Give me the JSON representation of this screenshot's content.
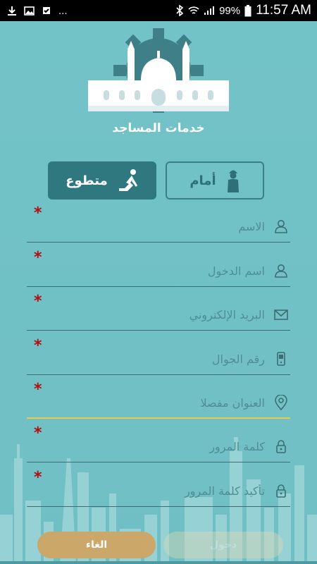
{
  "status_bar": {
    "battery": "99%",
    "time": "11:57 AM",
    "more": "..."
  },
  "app": {
    "title": "خدمات المساجد"
  },
  "roles": {
    "imam": "أمام",
    "volunteer": "متطوع"
  },
  "form": {
    "required_mark": "*",
    "fields": [
      {
        "placeholder": "الاسم",
        "icon": "user-icon"
      },
      {
        "placeholder": "اسم الدخول",
        "icon": "user-icon"
      },
      {
        "placeholder": "البريد الإلكتروني",
        "icon": "mail-icon"
      },
      {
        "placeholder": "رقم الجوال",
        "icon": "phone-icon"
      },
      {
        "placeholder": "العنوان مفصلا",
        "icon": "location-pin-icon"
      },
      {
        "placeholder": "كلمة المرور",
        "icon": "lock-icon"
      },
      {
        "placeholder": "تأكيد كلمة المرور",
        "icon": "lock-icon"
      }
    ]
  },
  "actions": {
    "cancel": "الغاء",
    "login": "دخول"
  },
  "colors": {
    "background": "#71c2c7",
    "selected_role": "#2f7880",
    "required": "#b10e0e",
    "cancel_button": "#cba86a",
    "active_underline": "#e9cc4f"
  }
}
